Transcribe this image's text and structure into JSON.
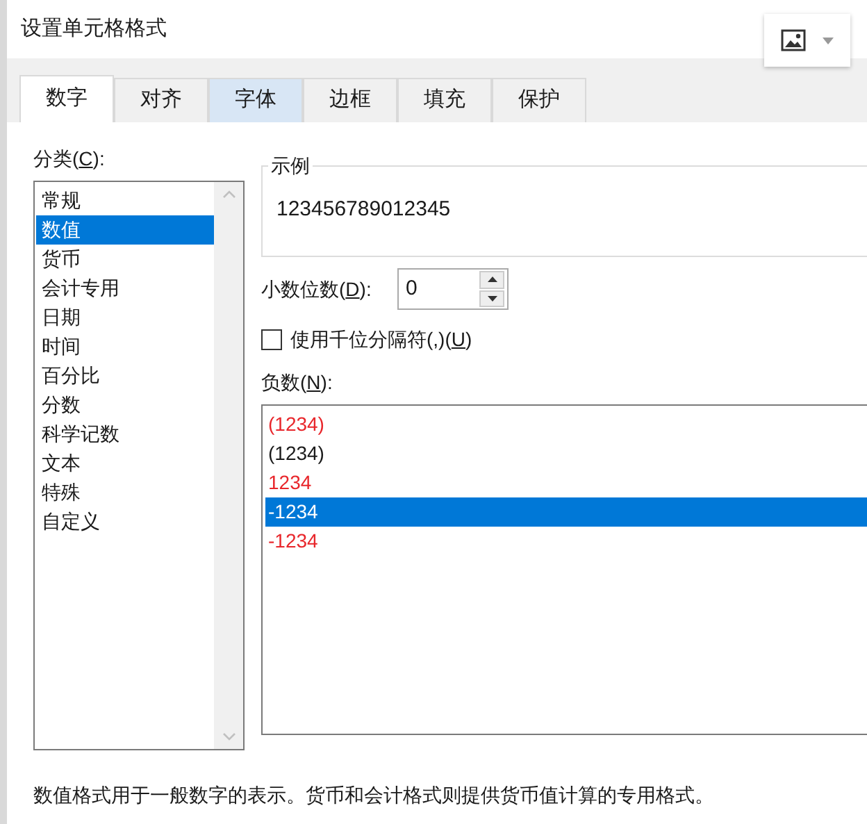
{
  "window": {
    "title": "设置单元格格式"
  },
  "tabs": [
    {
      "label": "数字",
      "selected": true,
      "hovered": false
    },
    {
      "label": "对齐",
      "selected": false,
      "hovered": false
    },
    {
      "label": "字体",
      "selected": false,
      "hovered": true
    },
    {
      "label": "边框",
      "selected": false,
      "hovered": false
    },
    {
      "label": "填充",
      "selected": false,
      "hovered": false
    },
    {
      "label": "保护",
      "selected": false,
      "hovered": false
    }
  ],
  "category": {
    "label_prefix": "分类(",
    "access_key": "C",
    "label_suffix": "):",
    "items": [
      {
        "label": "常规",
        "selected": false
      },
      {
        "label": "数值",
        "selected": true
      },
      {
        "label": "货币",
        "selected": false
      },
      {
        "label": "会计专用",
        "selected": false
      },
      {
        "label": "日期",
        "selected": false
      },
      {
        "label": "时间",
        "selected": false
      },
      {
        "label": "百分比",
        "selected": false
      },
      {
        "label": "分数",
        "selected": false
      },
      {
        "label": "科学记数",
        "selected": false
      },
      {
        "label": "文本",
        "selected": false
      },
      {
        "label": "特殊",
        "selected": false
      },
      {
        "label": "自定义",
        "selected": false
      }
    ]
  },
  "sample": {
    "label": "示例",
    "value": "123456789012345"
  },
  "decimal_places": {
    "label_prefix": "小数位数(",
    "access_key": "D",
    "label_suffix": "):",
    "value": "0"
  },
  "thousands_separator": {
    "label_prefix": "使用千位分隔符(,)(",
    "access_key": "U",
    "label_suffix": ")",
    "checked": false
  },
  "negative_numbers": {
    "label_prefix": "负数(",
    "access_key": "N",
    "label_suffix": "):",
    "items": [
      {
        "label": "(1234)",
        "color": "#e8262b",
        "selected": false
      },
      {
        "label": "(1234)",
        "color": "#1a1a1a",
        "selected": false
      },
      {
        "label": "1234",
        "color": "#e8262b",
        "selected": false
      },
      {
        "label": "-1234",
        "selected": true
      },
      {
        "label": "-1234",
        "color": "#e8262b",
        "selected": false
      }
    ]
  },
  "description": "数值格式用于一般数字的表示。货币和会计格式则提供货币值计算的专用格式。"
}
